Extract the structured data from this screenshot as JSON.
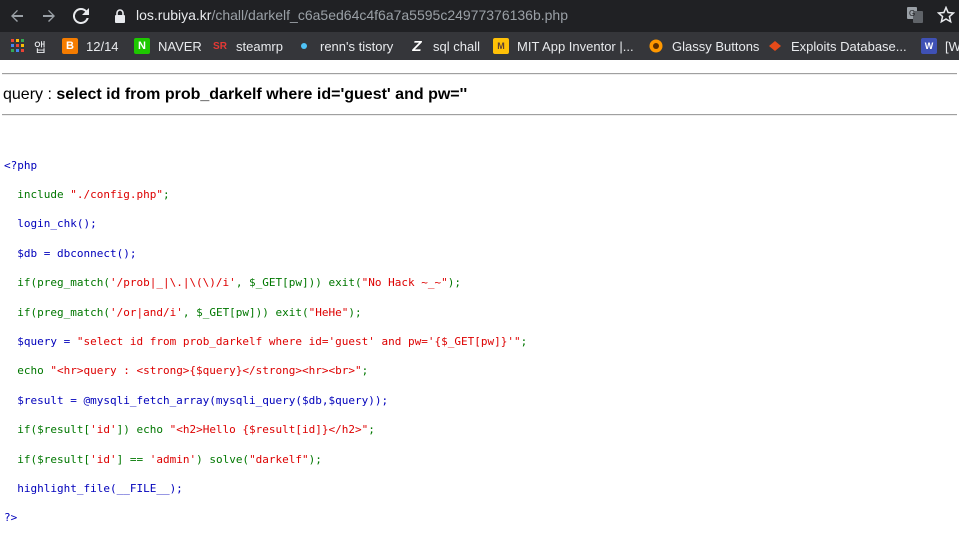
{
  "browser": {
    "url_host": "los.rubiya.kr",
    "url_path": "/chall/darkelf_c6a5ed64c4f6a7a5595c24977376136b.php",
    "icons": [
      "back-icon",
      "forward-icon",
      "reload-icon",
      "lock-icon",
      "translate-icon",
      "bookmark-star-icon"
    ]
  },
  "bookmarks": [
    {
      "icon": "apps-icon",
      "label": "앱",
      "color": "#e8eaed"
    },
    {
      "icon": "blogger-icon",
      "label": "12/14",
      "color": "#f57c00"
    },
    {
      "icon": "naver-icon",
      "label": "NAVER",
      "color": "#1ec800"
    },
    {
      "icon": "steamrp-icon",
      "label": "steamrp",
      "color": "#c62828"
    },
    {
      "icon": "tistory-icon",
      "label": "renn's tistory",
      "color": "#4fc3f7"
    },
    {
      "icon": "z-icon",
      "label": "sql chall",
      "color": "#ffffff"
    },
    {
      "icon": "mit-icon",
      "label": "MIT App Inventor |...",
      "color": "#ffc107"
    },
    {
      "icon": "glassy-icon",
      "label": "Glassy Buttons",
      "color": "#ff9800"
    },
    {
      "icon": "exploitdb-icon",
      "label": "Exploits Database...",
      "color": "#e64a19"
    },
    {
      "icon": "w-icon",
      "label": "[W",
      "color": "#3f51b5"
    }
  ],
  "page": {
    "query_prefix": "query : ",
    "query_sql": "select id from prob_darkelf where id='guest' and pw=''"
  },
  "code": {
    "l01_open": "<?php",
    "l02_a": "  include ",
    "l02_b": "\"./config.php\"",
    "l02_c": ";",
    "l03": "  login_chk();",
    "l04": "  $db = dbconnect();",
    "l05_a": "  if(preg_match(",
    "l05_b": "'/prob|_|\\.|\\(\\)/i'",
    "l05_c": ", $_GET[pw])) exit(",
    "l05_d": "\"No Hack ~_~\"",
    "l05_e": ");",
    "l06_a": "  if(preg_match(",
    "l06_b": "'/or|and/i'",
    "l06_c": ", $_GET[pw])) exit(",
    "l06_d": "\"HeHe\"",
    "l06_e": ");",
    "l07_a": "  $query = ",
    "l07_b": "\"select id from prob_darkelf where id='guest' and pw='{$_GET[pw]}'\"",
    "l07_c": ";",
    "l08_a": "  echo ",
    "l08_b": "\"<hr>query : <strong>{$query}</strong><hr><br>\"",
    "l08_c": ";",
    "l09": "  $result = @mysqli_fetch_array(mysqli_query($db,$query));",
    "l10_a": "  if($result[",
    "l10_b": "'id'",
    "l10_c": "]) echo ",
    "l10_d": "\"<h2>Hello {$result[id]}</h2>\"",
    "l10_e": ";",
    "l11_a": "  if($result[",
    "l11_b": "'id'",
    "l11_c": "] == ",
    "l11_d": "'admin'",
    "l11_e": ") solve(",
    "l11_f": "\"darkelf\"",
    "l11_g": ");",
    "l12": "  highlight_file(__FILE__);",
    "l13_close": "?>"
  }
}
